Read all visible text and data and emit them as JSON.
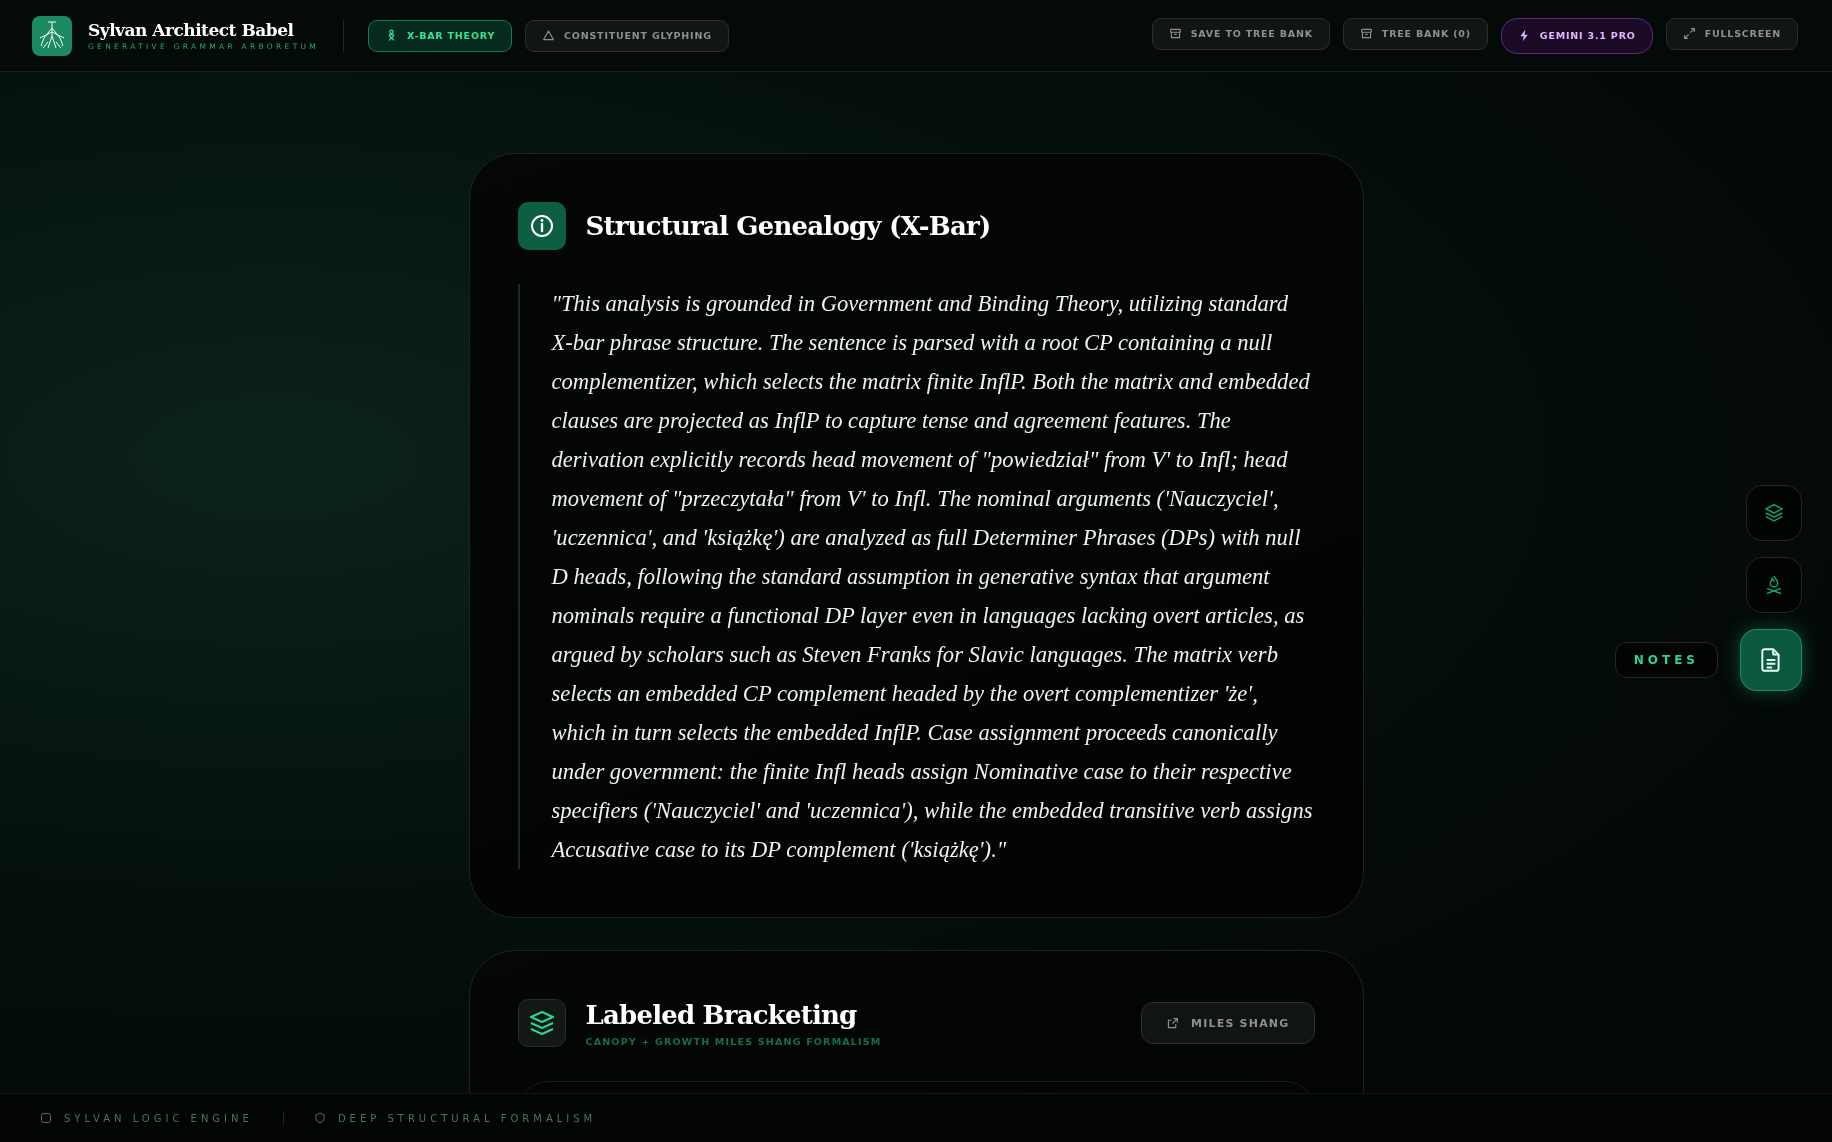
{
  "app": {
    "title": "Sylvan Architect Babel",
    "subtitle": "GENERATIVE GRAMMAR ARBORETUM"
  },
  "modes": [
    {
      "label": "X-BAR THEORY",
      "selected": true,
      "kind": "xbar"
    },
    {
      "label": "CONSTITUENT GLYPHING",
      "selected": false,
      "kind": "glyph"
    }
  ],
  "actions": [
    {
      "label": "SAVE TO TREE BANK",
      "kind": "save"
    },
    {
      "label": "TREE BANK (0)",
      "kind": "bank"
    },
    {
      "label": "GEMINI 3.1 PRO",
      "kind": "model"
    },
    {
      "label": "FULLSCREEN",
      "kind": "fullscreen"
    }
  ],
  "genealogy": {
    "title": "Structural Genealogy (X-Bar)",
    "quote": "\"This analysis is grounded in Government and Binding Theory, utilizing standard X-bar phrase structure. The sentence is parsed with a root CP containing a null complementizer, which selects the matrix finite InflP. Both the matrix and embedded clauses are projected as InflP to capture tense and agreement features. The derivation explicitly records head movement of \"powiedział\" from V' to Infl; head movement of \"przeczytała\" from V' to Infl. The nominal arguments ('Nauczyciel', 'uczennica', and 'książkę') are analyzed as full Determiner Phrases (DPs) with null D heads, following the standard assumption in generative syntax that argument nominals require a functional DP layer even in languages lacking overt articles, as argued by scholars such as Steven Franks for Slavic languages. The matrix verb selects an embedded CP complement headed by the overt complementizer 'że', which in turn selects the embedded InflP. Case assignment proceeds canonically under government: the finite Infl heads assign Nominative case to their respective specifiers ('Nauczyciel' and 'uczennica'), while the embedded transitive verb assigns Accusative case to its DP complement ('książkę').\""
  },
  "bracketing": {
    "title": "Labeled Bracketing",
    "subtitle": "CANOPY + GROWTH MILES SHANG FORMALISM",
    "link": "MILES SHANG"
  },
  "rail": [
    {
      "kind": "layers",
      "selected": false
    },
    {
      "kind": "fire",
      "selected": false
    },
    {
      "kind": "notes",
      "selected": true,
      "tooltip": "NOTES"
    }
  ],
  "footer": {
    "items": [
      "SYLVAN LOGIC ENGINE",
      "DEEP STRUCTURAL FORMALISM"
    ]
  }
}
